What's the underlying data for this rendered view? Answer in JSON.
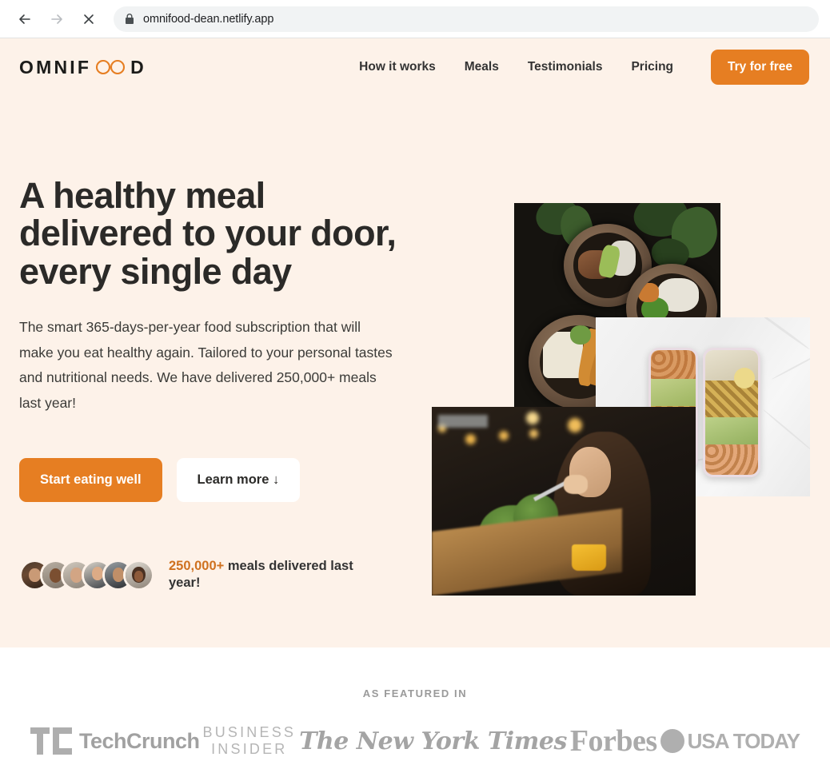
{
  "browser": {
    "back_icon": "arrow-left-icon",
    "forward_icon": "arrow-right-icon",
    "stop_icon": "close-icon",
    "lock_icon": "lock-icon",
    "url": "omnifood-dean.netlify.app"
  },
  "header": {
    "logo_prefix": "OMNIF",
    "logo_suffix": "D",
    "logo_infinity_icon": "infinity-icon",
    "nav": [
      {
        "label": "How it works"
      },
      {
        "label": "Meals"
      },
      {
        "label": "Testimonials"
      },
      {
        "label": "Pricing"
      }
    ],
    "cta_label": "Try for free"
  },
  "hero": {
    "title": "A healthy meal\ndelivered to your door,\nevery single day",
    "description": "The smart 365-days-per-year food subscription that will make you eat healthy again. Tailored to your personal tastes and nutritional needs. We have delivered 250,000+ meals last year!",
    "primary_cta": "Start eating well",
    "secondary_cta": "Learn more ↓",
    "delivered_count": "250,000+",
    "delivered_text": " meals delivered last year!",
    "avatar_count": 6,
    "images": [
      {
        "name": "food-bowls-photo",
        "alt": "Three bowls of healthy food on a dark table with herbs"
      },
      {
        "name": "meal-prep-photo",
        "alt": "Two meal prep containers with chickpeas and vegetables on marble"
      },
      {
        "name": "woman-eating-photo",
        "alt": "Woman eating a healthy meal at a restaurant"
      }
    ]
  },
  "featured": {
    "heading": "AS FEATURED IN",
    "logos": [
      {
        "name": "techcrunch-logo",
        "mark": "TC",
        "text": "TechCrunch"
      },
      {
        "name": "business-insider-logo",
        "line1": "BUSINESS",
        "line2": "INSIDER"
      },
      {
        "name": "new-york-times-logo",
        "text": "The New York Times"
      },
      {
        "name": "forbes-logo",
        "text": "Forbes"
      },
      {
        "name": "usa-today-logo",
        "text": "USA TODAY"
      }
    ]
  },
  "colors": {
    "brand_orange": "#e67e22",
    "brand_orange_dark": "#cf711f",
    "hero_bg": "#fdf2e9",
    "text_dark": "#2b2a28"
  }
}
